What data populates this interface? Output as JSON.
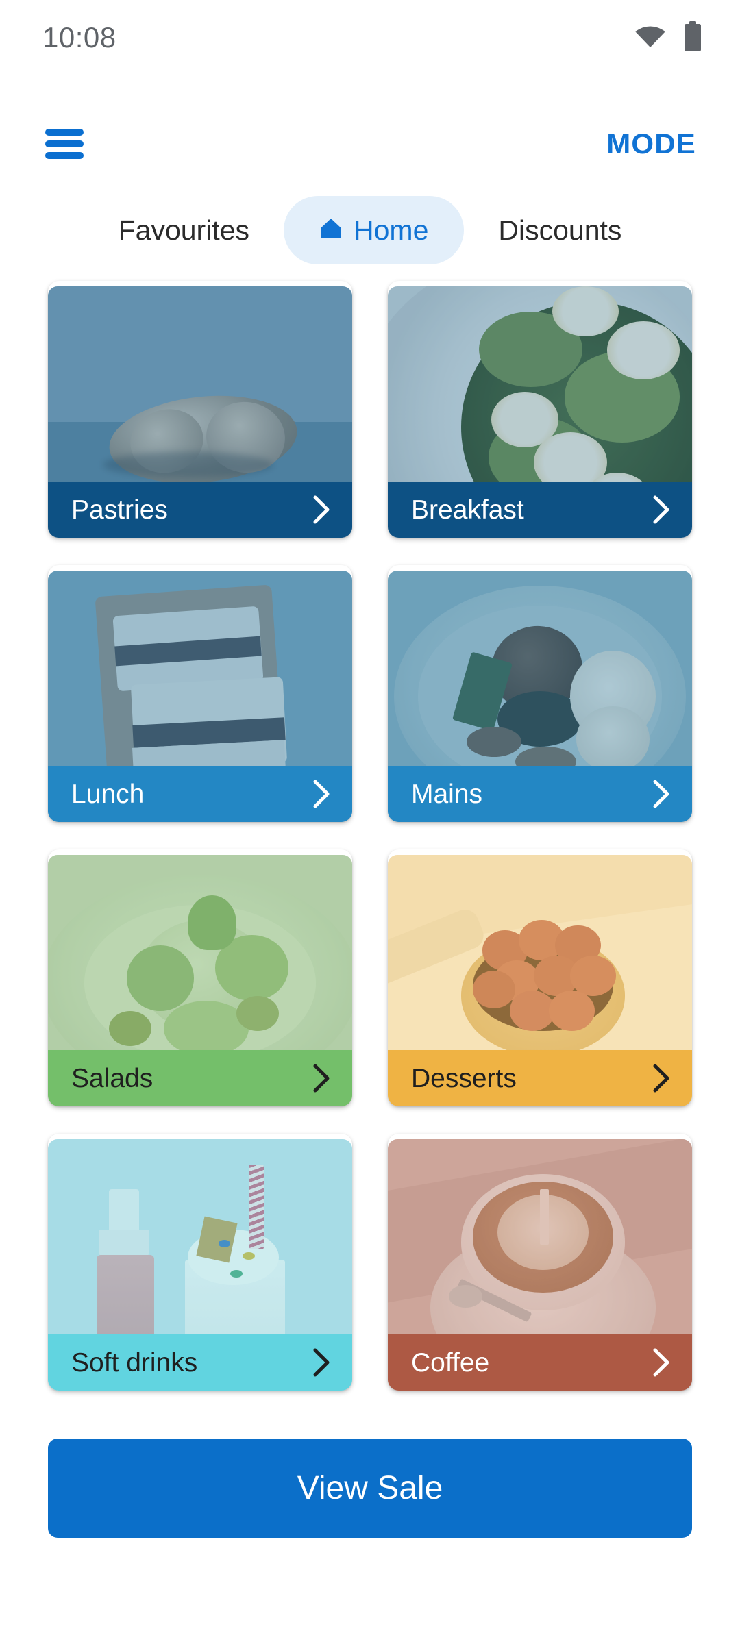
{
  "status_bar": {
    "time": "10:08",
    "wifi_icon": "wifi-icon",
    "battery_icon": "battery-icon"
  },
  "app_bar": {
    "menu_icon": "hamburger-menu-icon",
    "mode_label": "MODE"
  },
  "tabs": [
    {
      "label": "Favourites",
      "selected": false,
      "icon": null
    },
    {
      "label": "Home",
      "selected": true,
      "icon": "home-icon"
    },
    {
      "label": "Discounts",
      "selected": false,
      "icon": null
    }
  ],
  "categories": [
    {
      "label": "Pastries",
      "footer_color": "#0d5184",
      "text_color": "#ffffff",
      "chevron_icon": "chevron-right-icon",
      "photo": "croissant-on-blue-surface"
    },
    {
      "label": "Breakfast",
      "footer_color": "#0d5184",
      "text_color": "#ffffff",
      "chevron_icon": "chevron-right-icon",
      "photo": "avocado-toast-with-eggs"
    },
    {
      "label": "Lunch",
      "footer_color": "#2387c4",
      "text_color": "#ffffff",
      "chevron_icon": "chevron-right-icon",
      "photo": "sandwiches-on-board"
    },
    {
      "label": "Mains",
      "footer_color": "#2387c4",
      "text_color": "#ffffff",
      "chevron_icon": "chevron-right-icon",
      "photo": "steak-with-cauliflower"
    },
    {
      "label": "Salads",
      "footer_color": "#74bf6a",
      "text_color": "#1f1f1f",
      "chevron_icon": "chevron-right-icon",
      "photo": "green-salad-on-plate"
    },
    {
      "label": "Desserts",
      "footer_color": "#efb344",
      "text_color": "#1f1f1f",
      "chevron_icon": "chevron-right-icon",
      "photo": "raspberry-tart"
    },
    {
      "label": "Soft drinks",
      "footer_color": "#61d4e0",
      "text_color": "#1f1f1f",
      "chevron_icon": "chevron-right-icon",
      "photo": "bottle-and-milkshake"
    },
    {
      "label": "Coffee",
      "footer_color": "#ad5944",
      "text_color": "#ffffff",
      "chevron_icon": "chevron-right-icon",
      "photo": "cappuccino-with-latte-art"
    }
  ],
  "primary_action": {
    "label": "View Sale",
    "color": "#0b6fc9"
  },
  "theme": {
    "accent": "#1173d4",
    "selected_tab_bg": "#e3effa",
    "background": "#ffffff",
    "status_text": "#5f6368"
  }
}
